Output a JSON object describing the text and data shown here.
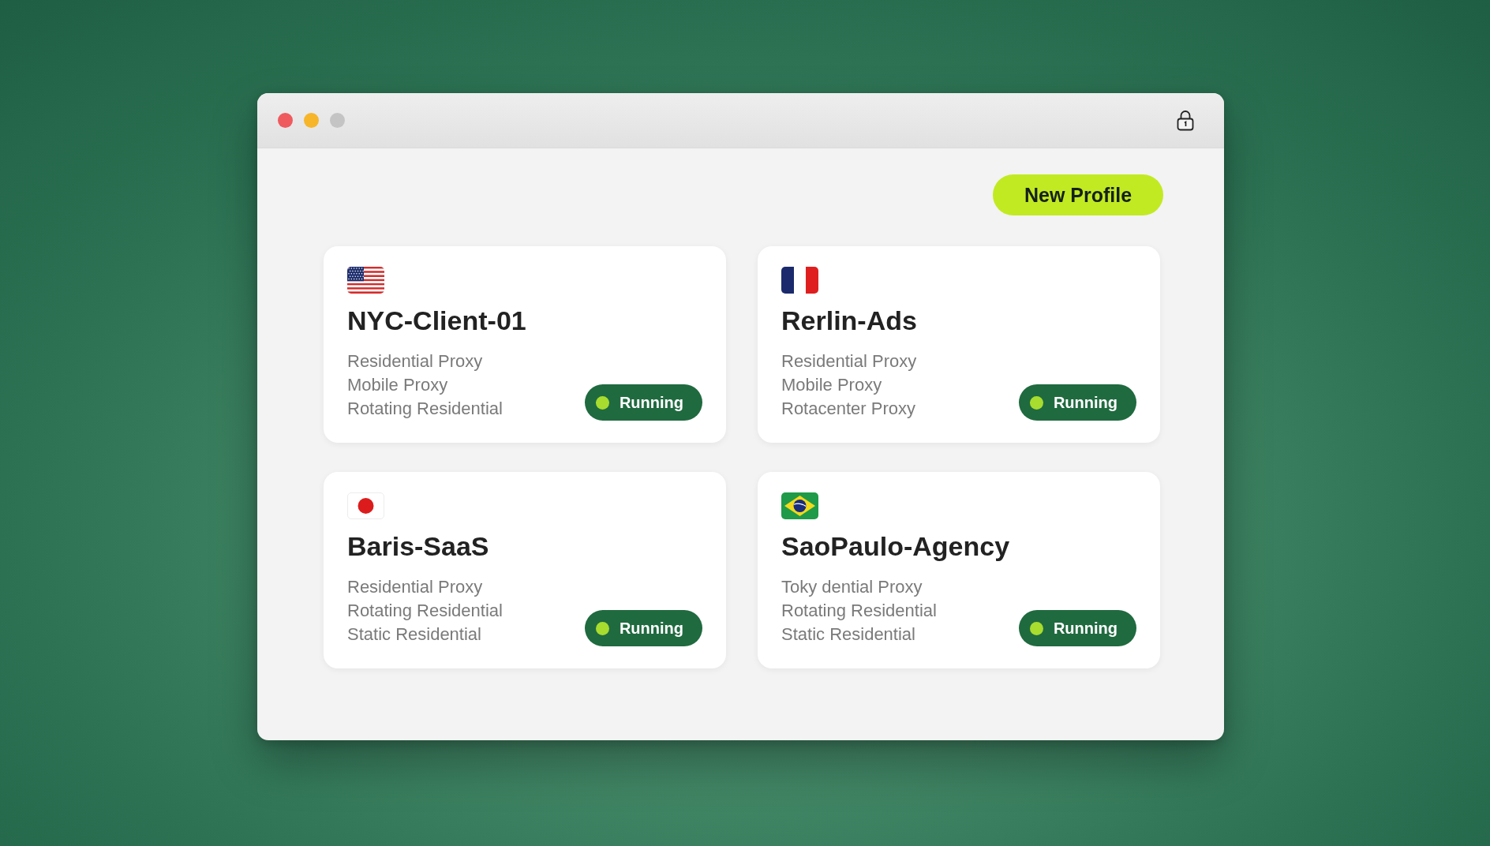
{
  "toolbar": {
    "new_profile_button": "New Profile"
  },
  "profiles": [
    {
      "flag": {
        "kind": "usa"
      },
      "name": "NYC-Client-01",
      "proxy_types": [
        "Residential Proxy",
        "Mobile Proxy",
        "Rotating Residential"
      ],
      "status": {
        "label": "Running",
        "running": true
      }
    },
    {
      "flag": {
        "kind": "france"
      },
      "name": "Rerlin-Ads",
      "proxy_types": [
        "Residential Proxy",
        "Mobile Proxy",
        "Rotacenter Proxy"
      ],
      "status": {
        "label": "Running",
        "running": true
      }
    },
    {
      "flag": {
        "kind": "japan"
      },
      "name": "Baris-SaaS",
      "proxy_types": [
        "Residential Proxy",
        "Rotating Residential",
        "Static Residential"
      ],
      "status": {
        "label": "Running",
        "running": true
      }
    },
    {
      "flag": {
        "kind": "brazil"
      },
      "name": "SaoPaulo-Agency",
      "proxy_types": [
        "Toky dential Proxy",
        "Rotating Residential",
        "Static Residential"
      ],
      "status": {
        "label": "Running",
        "running": true
      }
    }
  ]
}
